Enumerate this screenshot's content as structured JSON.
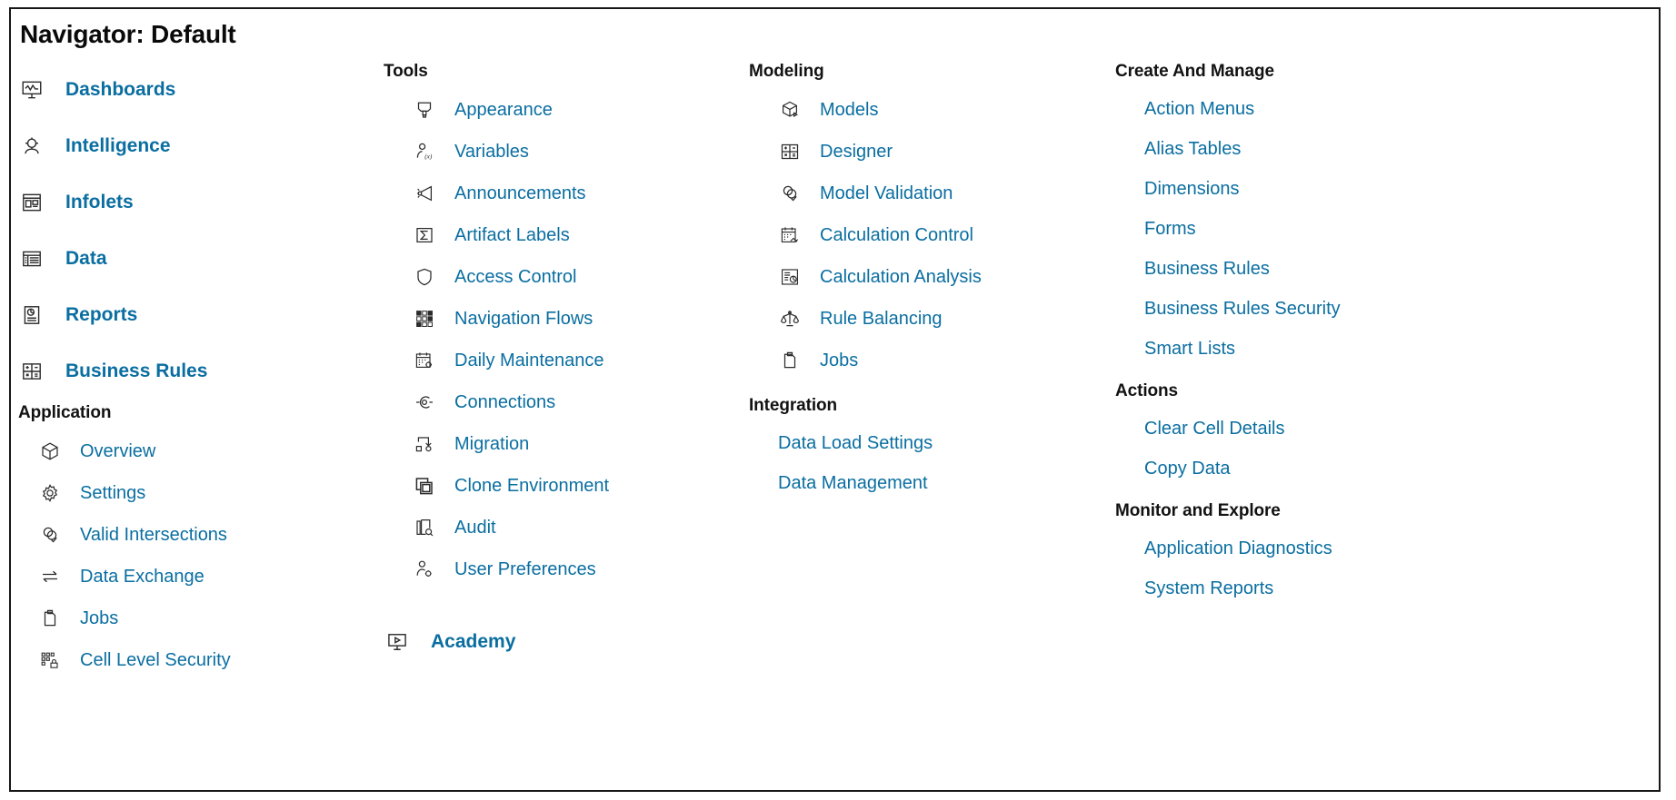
{
  "window": {
    "title": "Navigator: Default"
  },
  "theme": {
    "link_color": "#0a6ea1",
    "text_color": "#121212",
    "border_color": "#171717",
    "background": "#ffffff"
  },
  "columns": {
    "column_1": {
      "primary_items": [
        {
          "label": "Dashboards",
          "icon": "dashboard-monitor-icon"
        },
        {
          "label": "Intelligence",
          "icon": "intelligence-person-icon"
        },
        {
          "label": "Infolets",
          "icon": "infolets-panel-icon"
        },
        {
          "label": "Data",
          "icon": "data-grid-icon"
        },
        {
          "label": "Reports",
          "icon": "reports-document-icon"
        },
        {
          "label": "Business Rules",
          "icon": "calculator-icon"
        }
      ],
      "application": {
        "header": "Application",
        "items": [
          {
            "label": "Overview",
            "icon": "cube-icon"
          },
          {
            "label": "Settings",
            "icon": "gear-icon"
          },
          {
            "label": "Valid Intersections",
            "icon": "venn-check-icon"
          },
          {
            "label": "Data Exchange",
            "icon": "exchange-arrows-icon"
          },
          {
            "label": "Jobs",
            "icon": "clipboard-icon"
          },
          {
            "label": "Cell Level Security",
            "icon": "cell-lock-icon"
          }
        ]
      }
    },
    "column_2": {
      "tools": {
        "header": "Tools",
        "items": [
          {
            "label": "Appearance",
            "icon": "appearance-paint-icon"
          },
          {
            "label": "Variables",
            "icon": "variables-person-x-icon"
          },
          {
            "label": "Announcements",
            "icon": "megaphone-icon"
          },
          {
            "label": "Artifact Labels",
            "icon": "sigma-box-icon"
          },
          {
            "label": "Access Control",
            "icon": "shield-icon"
          },
          {
            "label": "Navigation Flows",
            "icon": "grid-blocks-icon"
          },
          {
            "label": "Daily Maintenance",
            "icon": "calendar-gear-icon"
          },
          {
            "label": "Connections",
            "icon": "connection-node-icon"
          },
          {
            "label": "Migration",
            "icon": "migration-arrow-icon"
          },
          {
            "label": "Clone Environment",
            "icon": "clone-windows-icon"
          },
          {
            "label": "Audit",
            "icon": "audit-search-icon"
          },
          {
            "label": "User Preferences",
            "icon": "user-gear-icon"
          }
        ]
      },
      "academy": {
        "label": "Academy",
        "icon": "academy-screen-play-icon"
      }
    },
    "column_3": {
      "modeling": {
        "header": "Modeling",
        "items": [
          {
            "label": "Models",
            "icon": "cube-play-icon"
          },
          {
            "label": "Designer",
            "icon": "calculator-icon"
          },
          {
            "label": "Model Validation",
            "icon": "venn-check-icon"
          },
          {
            "label": "Calculation Control",
            "icon": "calendar-calc-icon"
          },
          {
            "label": "Calculation Analysis",
            "icon": "analysis-chart-icon"
          },
          {
            "label": "Rule Balancing",
            "icon": "scales-icon"
          },
          {
            "label": "Jobs",
            "icon": "clipboard-icon"
          }
        ]
      },
      "integration": {
        "header": "Integration",
        "items": [
          {
            "label": "Data Load Settings"
          },
          {
            "label": "Data Management"
          }
        ]
      }
    },
    "column_4": {
      "create_and_manage": {
        "header": "Create And Manage",
        "items": [
          {
            "label": "Action Menus"
          },
          {
            "label": "Alias Tables"
          },
          {
            "label": "Dimensions"
          },
          {
            "label": "Forms"
          },
          {
            "label": "Business Rules"
          },
          {
            "label": "Business Rules Security"
          },
          {
            "label": "Smart Lists"
          }
        ]
      },
      "actions": {
        "header": "Actions",
        "items": [
          {
            "label": "Clear Cell Details"
          },
          {
            "label": "Copy Data"
          }
        ]
      },
      "monitor_and_explore": {
        "header": "Monitor and Explore",
        "items": [
          {
            "label": "Application Diagnostics"
          },
          {
            "label": "System Reports"
          }
        ]
      }
    }
  }
}
